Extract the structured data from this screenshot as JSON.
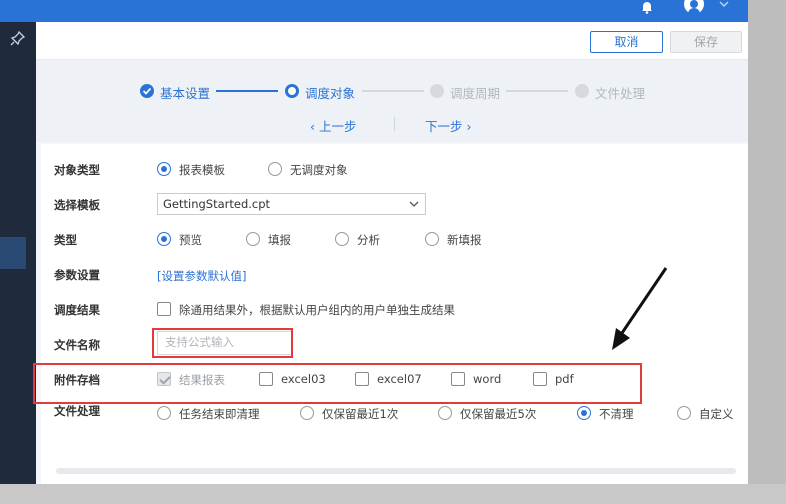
{
  "toolbar": {
    "cancel_label": "取消",
    "save_label": "保存"
  },
  "steps": {
    "items": [
      {
        "label": "基本设置",
        "status": "done"
      },
      {
        "label": "调度对象",
        "status": "active"
      },
      {
        "label": "调度周期",
        "status": "pending"
      },
      {
        "label": "文件处理",
        "status": "pending"
      }
    ],
    "prev_label": "‹ 上一步",
    "next_label": "下一步 ›"
  },
  "form": {
    "object_type": {
      "label": "对象类型",
      "options": [
        "报表模板",
        "无调度对象"
      ],
      "selected": "报表模板"
    },
    "template": {
      "label": "选择模板",
      "value": "GettingStarted.cpt"
    },
    "type": {
      "label": "类型",
      "options": [
        "预览",
        "填报",
        "分析",
        "新填报"
      ],
      "selected": "预览"
    },
    "params": {
      "label": "参数设置",
      "link": "[设置参数默认值]"
    },
    "result": {
      "label": "调度结果",
      "checkbox_label": "除通用结果外，根据默认用户组内的用户单独生成结果"
    },
    "file_name": {
      "label": "文件名称",
      "placeholder": "支持公式输入"
    },
    "attachment": {
      "label": "附件存档",
      "options": [
        "结果报表",
        "excel03",
        "excel07",
        "word",
        "pdf"
      ]
    },
    "file_handling": {
      "label": "文件处理",
      "options": [
        "任务结束即清理",
        "仅保留最近1次",
        "仅保留最近5次",
        "不清理",
        "自定义"
      ],
      "selected": "不清理"
    }
  },
  "colors": {
    "accent": "#2a73d6",
    "highlight": "#e03c3c",
    "sidebar": "#1f2b3d"
  },
  "icons": [
    "bell-icon",
    "user-icon",
    "chevron-down-icon",
    "pin-icon",
    "check-circle-icon"
  ]
}
